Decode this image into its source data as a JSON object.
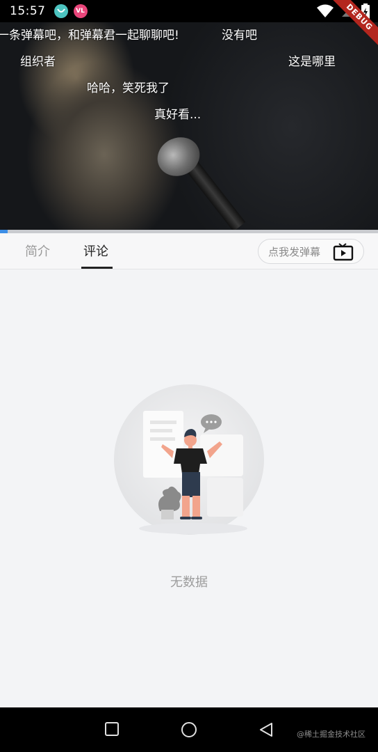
{
  "status_bar": {
    "time": "15:57",
    "debug_label": "DEBUG"
  },
  "video": {
    "danmaku": [
      "一条弹幕吧，和弹幕君一起聊聊吧!",
      "没有吧",
      "组织者",
      "这是哪里",
      "哈哈，笑死我了",
      "真好看..."
    ],
    "progress": 0.02,
    "accent_color": "#3d8ee6"
  },
  "tabs": [
    {
      "label": "简介",
      "active": false
    },
    {
      "label": "评论",
      "active": true
    }
  ],
  "danmaku_button": {
    "label": "点我发弹幕",
    "icon": "tv-play-icon"
  },
  "empty_state": {
    "message": "无数据",
    "icon": "empty-person-shrug-illustration"
  },
  "nav_bar": {
    "icons": [
      "square-recents-icon",
      "circle-home-icon",
      "triangle-back-icon"
    ],
    "watermark": "@稀土掘金技术社区"
  }
}
